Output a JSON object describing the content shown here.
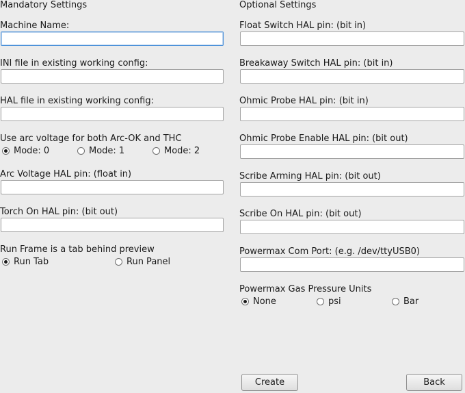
{
  "mandatory": {
    "title": "Mandatory Settings",
    "machine_name": {
      "label": "Machine Name:",
      "value": ""
    },
    "ini_file": {
      "label": "INI file in existing working config:",
      "value": ""
    },
    "hal_file": {
      "label": "HAL file in existing working config:",
      "value": ""
    },
    "arc_voltage_mode": {
      "label": "Use arc voltage for both Arc-OK and THC",
      "options": [
        "Mode: 0",
        "Mode: 1",
        "Mode: 2"
      ],
      "selected": "Mode: 0"
    },
    "arc_voltage_pin": {
      "label": "Arc Voltage HAL pin: (float in)",
      "value": ""
    },
    "torch_on_pin": {
      "label": "Torch On HAL pin: (bit out)",
      "value": ""
    },
    "run_frame": {
      "label": "Run Frame is a tab behind preview",
      "options": [
        "Run Tab",
        "Run Panel"
      ],
      "selected": "Run Tab"
    }
  },
  "optional": {
    "title": "Optional Settings",
    "float_switch_pin": {
      "label": "Float Switch HAL pin: (bit in)",
      "value": ""
    },
    "breakaway_switch_pin": {
      "label": "Breakaway Switch HAL pin: (bit in)",
      "value": ""
    },
    "ohmic_probe_pin": {
      "label": "Ohmic Probe HAL pin: (bit in)",
      "value": ""
    },
    "ohmic_probe_enable_pin": {
      "label": "Ohmic Probe Enable HAL pin: (bit out)",
      "value": ""
    },
    "scribe_arming_pin": {
      "label": "Scribe Arming HAL pin: (bit out)",
      "value": ""
    },
    "scribe_on_pin": {
      "label": "Scribe On HAL pin: (bit out)",
      "value": ""
    },
    "powermax_com_port": {
      "label": "Powermax Com Port: (e.g. /dev/ttyUSB0)",
      "value": ""
    },
    "gas_pressure_units": {
      "label": "Powermax Gas Pressure Units",
      "options": [
        "None",
        "psi",
        "Bar"
      ],
      "selected": "None"
    }
  },
  "buttons": {
    "create": "Create",
    "back": "Back"
  }
}
